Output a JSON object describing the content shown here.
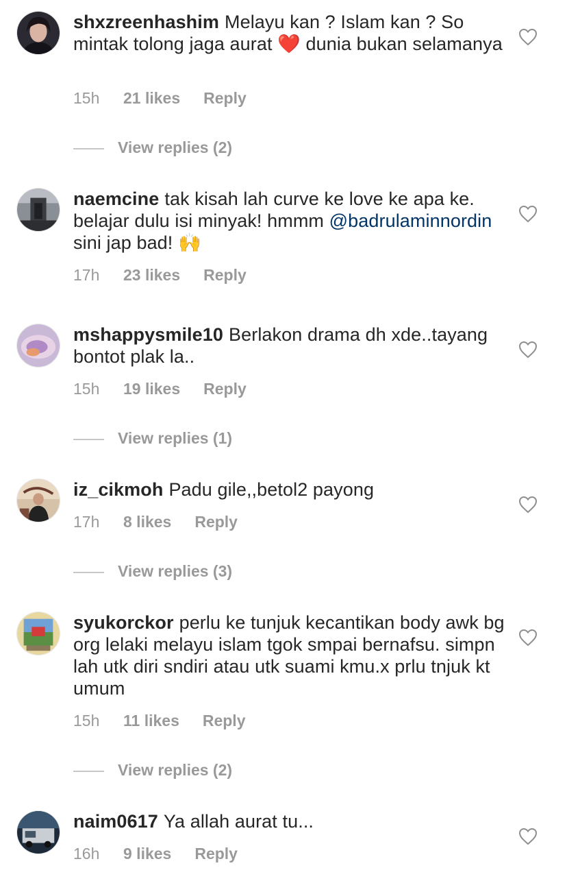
{
  "comments": [
    {
      "username": "shxzreenhashim",
      "text_before": "Melayu kan ? Islam kan ? So mintak tolong jaga aurat ",
      "emoji": "❤️",
      "text_after": " dunia bukan selamanya",
      "time": "15h",
      "likes": "21 likes",
      "reply": "Reply",
      "view_replies": "View replies (2)"
    },
    {
      "username": "naemcine",
      "text_before": "tak kisah lah curve ke love ke apa ke. belajar dulu isi minyak! hmmm ",
      "mention": "@badrulaminnordin",
      "text_after": " sini jap bad! ",
      "emoji": "🙌",
      "time": "17h",
      "likes": "23 likes",
      "reply": "Reply"
    },
    {
      "username": "mshappysmile10",
      "text": "Berlakon drama dh xde..tayang bontot plak la..",
      "time": "15h",
      "likes": "19 likes",
      "reply": "Reply",
      "view_replies": "View replies (1)"
    },
    {
      "username": "iz_cikmoh",
      "text": "Padu gile,,betol2 payong",
      "time": "17h",
      "likes": "8 likes",
      "reply": "Reply",
      "view_replies": "View replies (3)"
    },
    {
      "username": "syukorckor",
      "text": "perlu ke tunjuk kecantikan body awk bg org lelaki melayu islam tgok smpai bernafsu. simpn lah utk diri sndiri atau utk suami kmu.x prlu tnjuk kt umum",
      "time": "15h",
      "likes": "11 likes",
      "reply": "Reply",
      "view_replies": "View replies (2)"
    },
    {
      "username": "naim0617",
      "text": "Ya allah aurat tu...",
      "time": "16h",
      "likes": "9 likes",
      "reply": "Reply"
    }
  ],
  "icons": {
    "like": "heart-outline-icon"
  },
  "colors": {
    "text": "#262626",
    "meta": "#999999",
    "mention": "#003569"
  }
}
